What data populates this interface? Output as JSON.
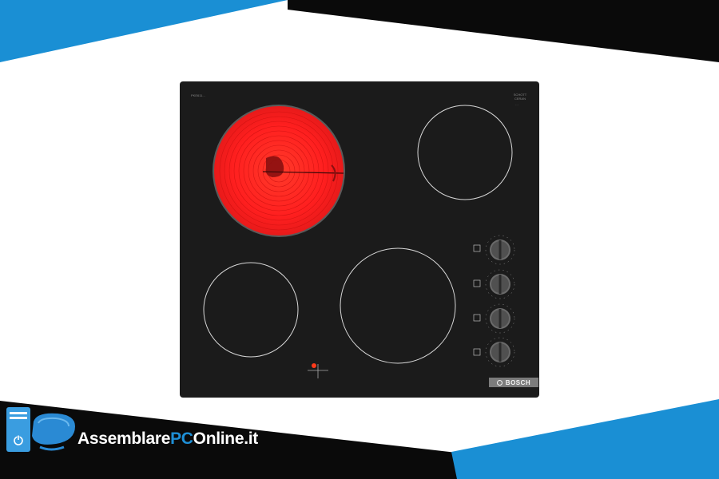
{
  "colors": {
    "accent_blue": "#1a8fd4",
    "dark": "#0a0a0a",
    "cooktop_glass": "#1b1b1b",
    "hot_zone": "#ff2020"
  },
  "hob": {
    "brand": "BOSCH",
    "model_label": "PKE611...",
    "corner_label": "SCHOTT CERAN",
    "corner_sub": "…",
    "knob_count": 4,
    "active_zone": "rear-left"
  },
  "site": {
    "name_prefix": "Assemblare",
    "name_accent": "PC",
    "name_suffix": "Online.it"
  },
  "icons": {
    "logo": "computer-tower-monitor-icon",
    "power": "power-icon"
  }
}
